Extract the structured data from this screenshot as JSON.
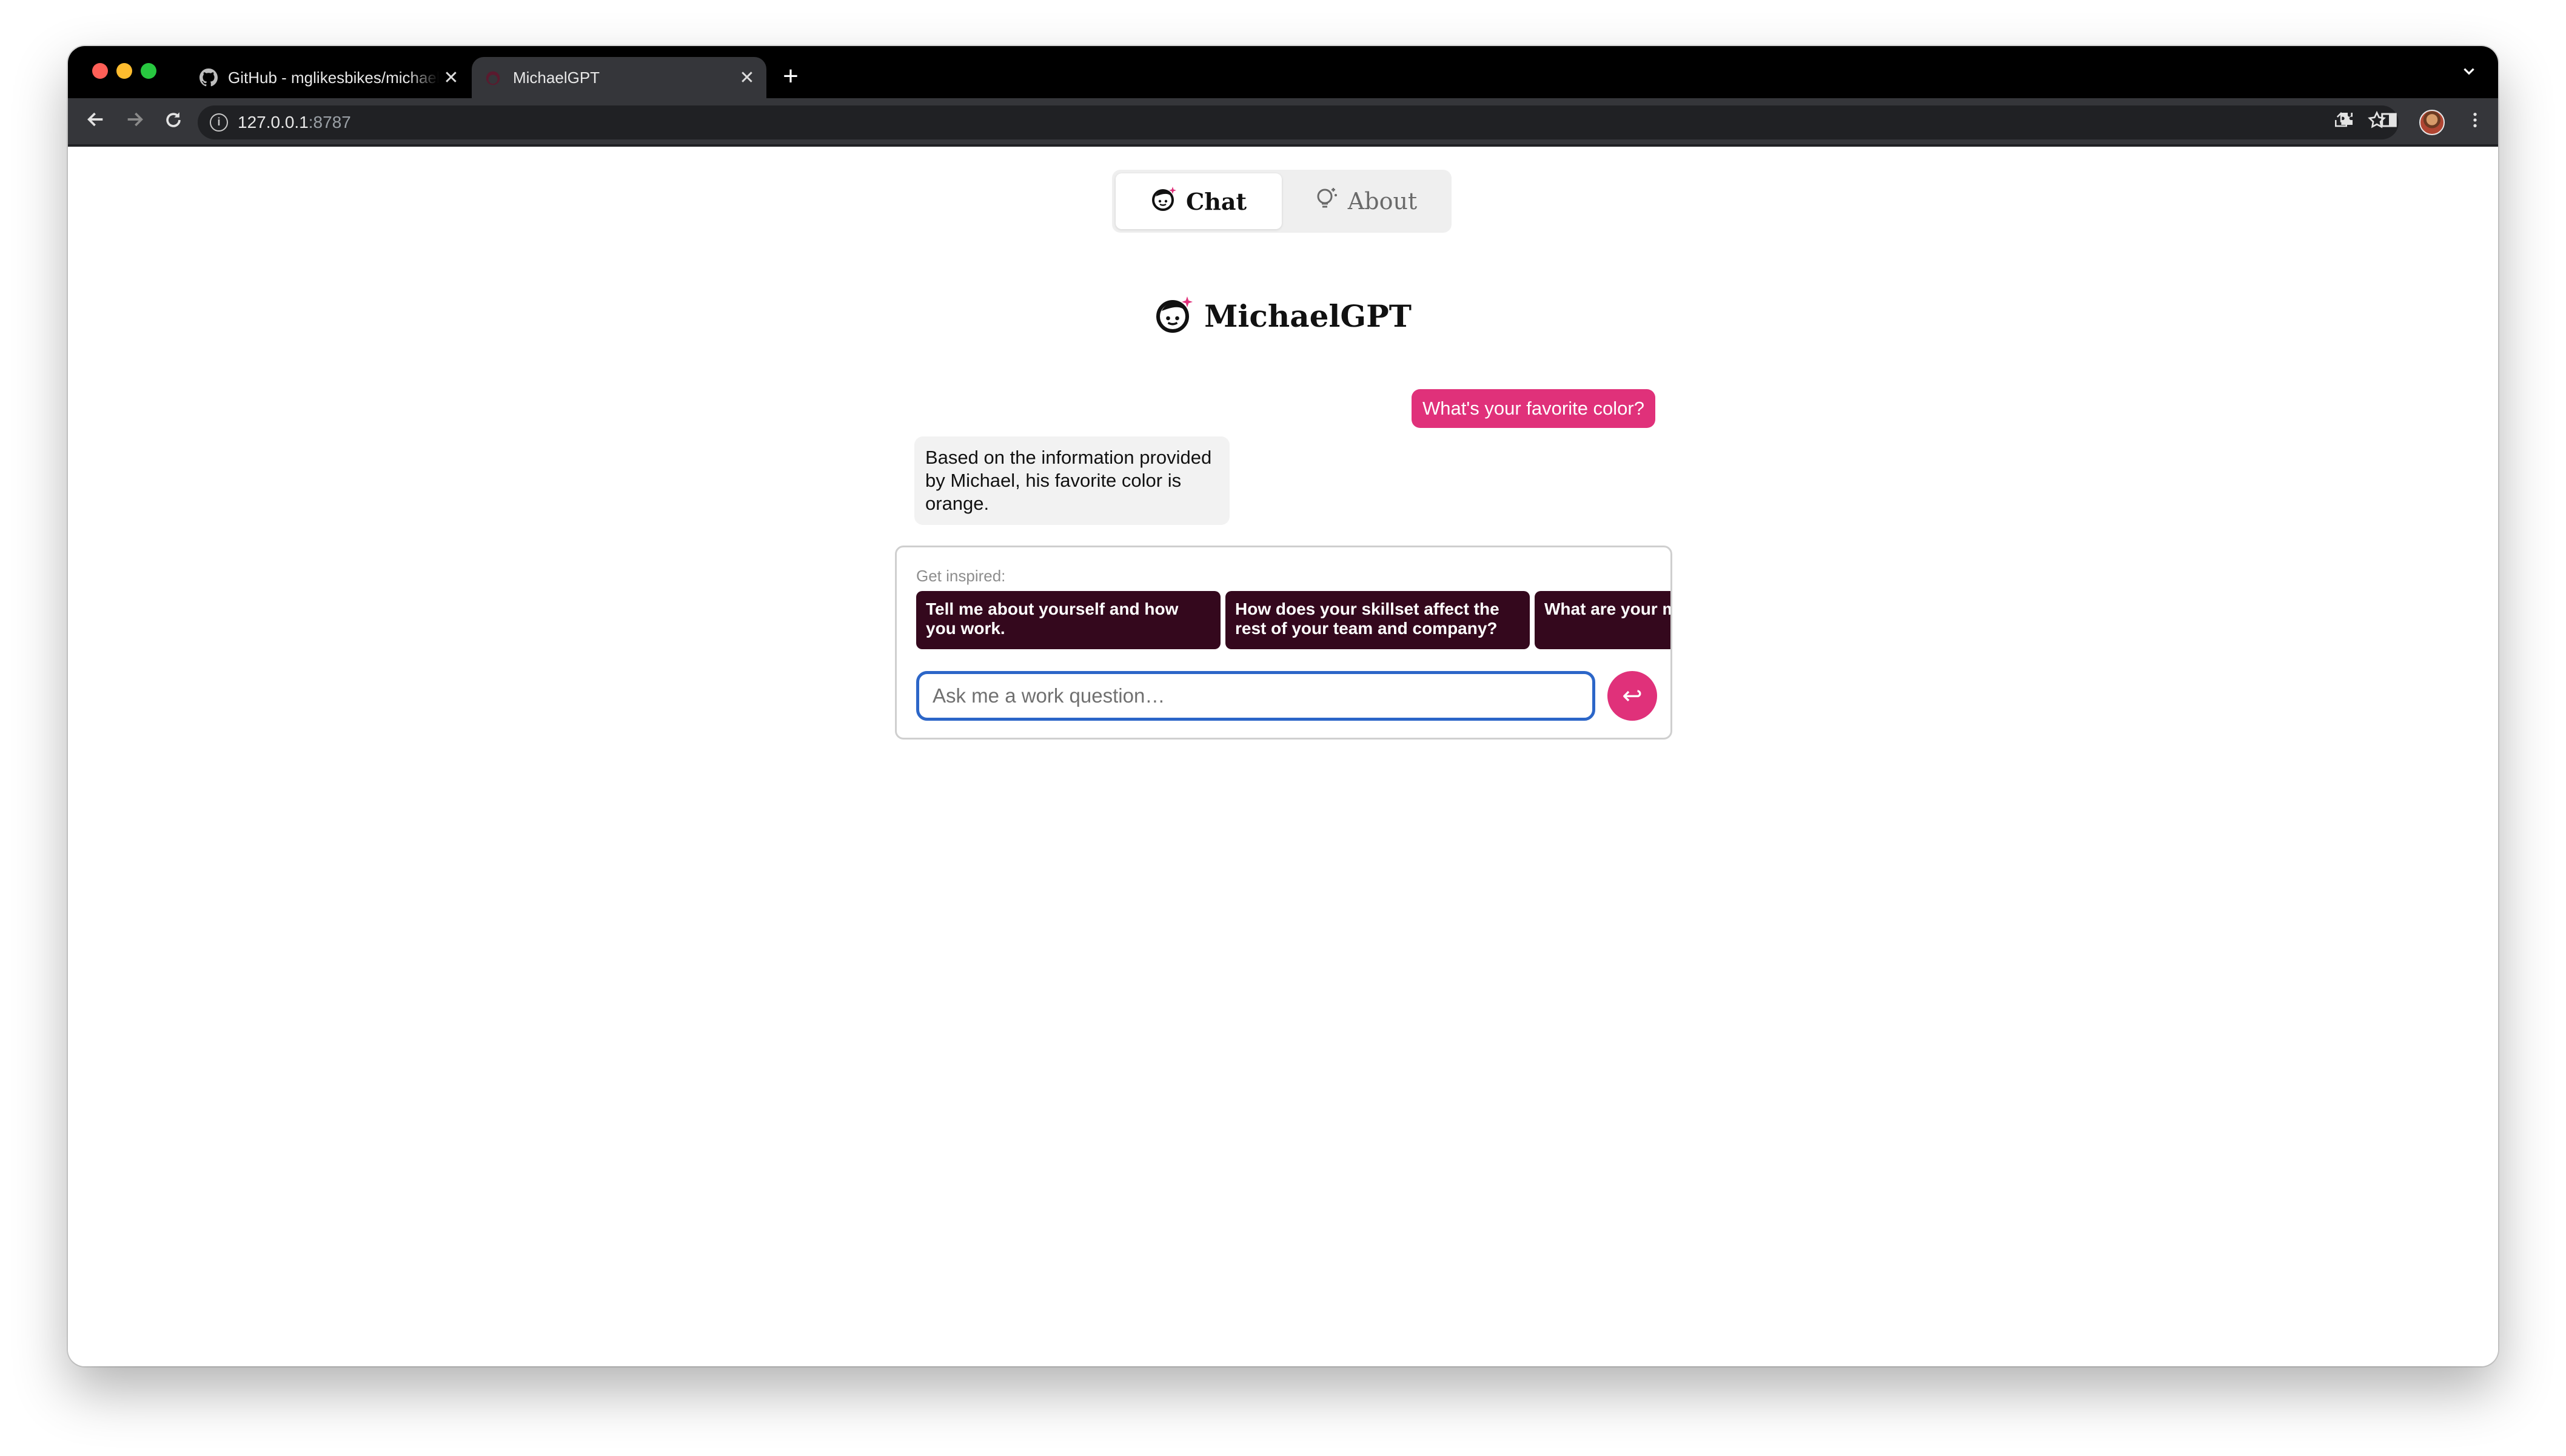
{
  "browser": {
    "tabs": [
      {
        "title": "GitHub - mglikesbikes/michaelgpt",
        "favicon": "github-icon",
        "active": false
      },
      {
        "title": "MichaelGPT",
        "favicon": "michaelgpt-logo-icon",
        "active": true
      }
    ],
    "new_tab_symbol": "+",
    "close_symbol": "✕",
    "url_host": "127.0.0.1",
    "url_port": ":8787"
  },
  "nav": {
    "tabs": [
      {
        "label": "Chat",
        "icon": "michaelgpt-face-icon",
        "selected": true
      },
      {
        "label": "About",
        "icon": "lightbulb-icon",
        "selected": false
      }
    ]
  },
  "brand": {
    "title": "MichaelGPT"
  },
  "chat": {
    "messages": [
      {
        "role": "user",
        "text": "What's your favorite color?"
      },
      {
        "role": "assistant",
        "text": "Based on the information provided by Michael, his favorite color is orange."
      }
    ]
  },
  "composer": {
    "inspired_label": "Get inspired:",
    "suggestions": [
      "Tell me about yourself and how you work.",
      "How does your skillset affect the rest of your team and company?",
      "What are your m when it comes t"
    ],
    "placeholder": "Ask me a work question…",
    "send_symbol": "↩"
  },
  "colors": {
    "accent_pink": "#e0317a",
    "suggestion_bg": "#34081d",
    "input_border": "#2c66c8"
  }
}
